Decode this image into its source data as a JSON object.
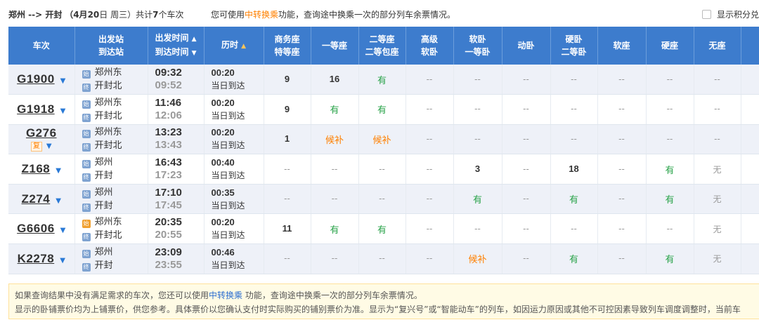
{
  "summary": {
    "route": "郑州 --> 开封",
    "date_prefix": "（4月",
    "date_day": "20",
    "date_suffix": "日  周三）共计",
    "count": "7",
    "count_suffix": "个车次",
    "tip_prefix": "您可使用",
    "tip_link": "中转换乘",
    "tip_suffix": "功能，查询途中换乘一次的部分列车余票情况。",
    "points_label": "显示积分兑"
  },
  "headers": {
    "train": "车次",
    "station_from": "出发站",
    "station_to": "到达站",
    "time_dep": "出发时间",
    "time_arr": "到达时间",
    "duration": "历时",
    "business_1": "商务座",
    "business_2": "特等座",
    "first": "一等座",
    "second_1": "二等座",
    "second_2": "二等包座",
    "adv_1": "高级",
    "adv_2": "软卧",
    "soft_1": "软卧",
    "soft_2": "一等卧",
    "motion": "动卧",
    "hard_1": "硬卧",
    "hard_2": "二等卧",
    "softseat": "软座",
    "hardseat": "硬座",
    "noseat": "无座"
  },
  "colors": {
    "header_bg": "#3d7ccd",
    "available": "#2aa34a",
    "waitlist": "#ff8000",
    "row_alt": "#eef1f8"
  },
  "trains": [
    {
      "no": "G1900",
      "fu": "",
      "from": "郑州东",
      "to": "开封北",
      "dep": "09:32",
      "arr": "09:52",
      "dur": "00:20",
      "arrive": "当日到达",
      "seats": [
        "9",
        "16",
        "有",
        "--",
        "--",
        "--",
        "--",
        "--",
        "--",
        "--"
      ]
    },
    {
      "no": "G1918",
      "fu": "",
      "from": "郑州东",
      "to": "开封北",
      "dep": "11:46",
      "arr": "12:06",
      "dur": "00:20",
      "arrive": "当日到达",
      "seats": [
        "9",
        "有",
        "有",
        "--",
        "--",
        "--",
        "--",
        "--",
        "--",
        "--"
      ]
    },
    {
      "no": "G276",
      "fu": "复",
      "from": "郑州东",
      "to": "开封北",
      "dep": "13:23",
      "arr": "13:43",
      "dur": "00:20",
      "arrive": "当日到达",
      "seats": [
        "1",
        "候补",
        "候补",
        "--",
        "--",
        "--",
        "--",
        "--",
        "--",
        "--"
      ]
    },
    {
      "no": "Z168",
      "fu": "",
      "from": "郑州",
      "to": "开封",
      "dep": "16:43",
      "arr": "17:23",
      "dur": "00:40",
      "arrive": "当日到达",
      "seats": [
        "--",
        "--",
        "--",
        "--",
        "3",
        "--",
        "18",
        "--",
        "有",
        "无"
      ]
    },
    {
      "no": "Z274",
      "fu": "",
      "from": "郑州",
      "to": "开封",
      "dep": "17:10",
      "arr": "17:45",
      "dur": "00:35",
      "arrive": "当日到达",
      "seats": [
        "--",
        "--",
        "--",
        "--",
        "有",
        "--",
        "有",
        "--",
        "有",
        "无"
      ]
    },
    {
      "no": "G6606",
      "fu": "",
      "from": "郑州东",
      "to": "开封北",
      "dep": "20:35",
      "arr": "20:55",
      "dur": "00:20",
      "arrive": "当日到达",
      "seats": [
        "11",
        "有",
        "有",
        "--",
        "--",
        "--",
        "--",
        "--",
        "--",
        "无"
      ]
    },
    {
      "no": "K2278",
      "fu": "",
      "from": "郑州",
      "to": "开封",
      "dep": "23:09",
      "arr": "23:55",
      "dur": "00:46",
      "arrive": "当日到达",
      "seats": [
        "--",
        "--",
        "--",
        "--",
        "候补",
        "--",
        "有",
        "--",
        "有",
        "无"
      ]
    }
  ],
  "notice": {
    "line1_prefix": "如果查询结果中没有满足需求的车次，您还可以使用",
    "line1_link": "中转换乘",
    "line1_suffix": " 功能，查询途中换乘一次的部分列车余票情况。",
    "line2": "显示的卧铺票价均为上铺票价，供您参考。具体票价以您确认支付时实际购买的铺别票价为准。显示为“复兴号”或“智能动车”的列车，如因运力原因或其他不可控因素导致列车调度调整时，当前车"
  }
}
